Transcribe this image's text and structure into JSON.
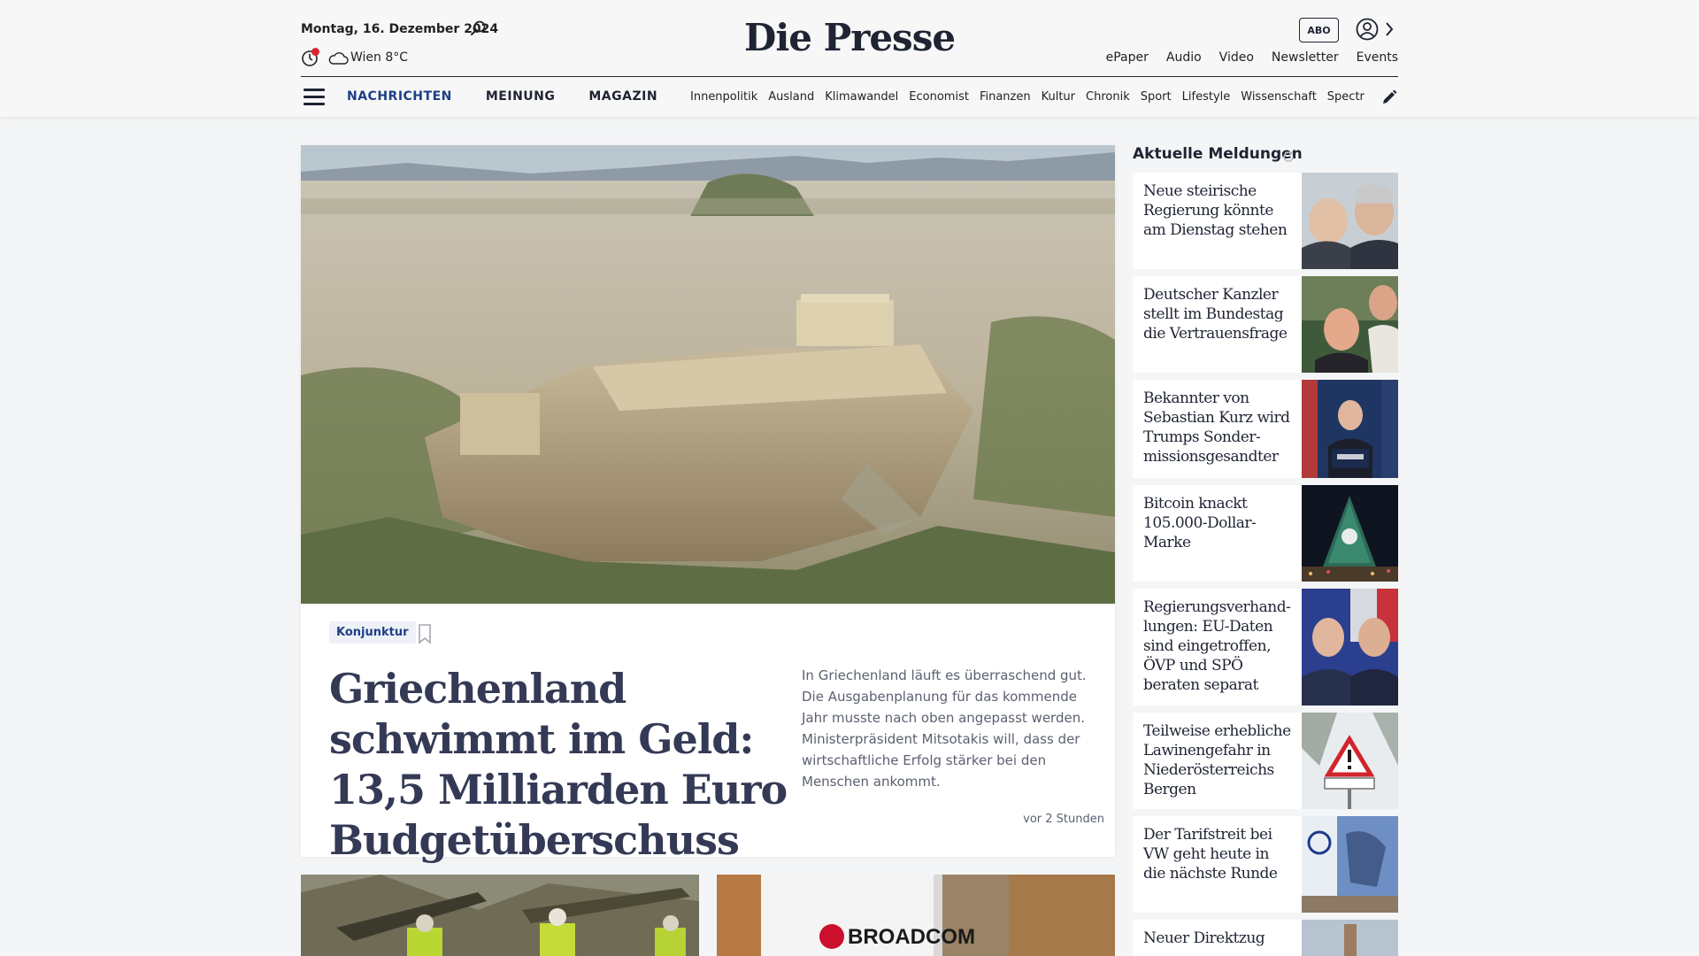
{
  "header": {
    "date": "Montag, 16. Dezember 2024",
    "weather": "Wien 8°C",
    "logo": "Die Presse",
    "abo_label": "ABO",
    "top_links": [
      "ePaper",
      "Audio",
      "Video",
      "Newsletter",
      "Events"
    ],
    "main_nav": [
      "NACHRICHTEN",
      "MEINUNG",
      "MAGAZIN"
    ],
    "sub_nav": [
      "Innenpolitik",
      "Ausland",
      "Klimawandel",
      "Economist",
      "Finanzen",
      "Kultur",
      "Chronik",
      "Sport",
      "Lifestyle",
      "Wissenschaft",
      "Spectrum"
    ]
  },
  "hero": {
    "tag": "Konjunktur",
    "title": "Griechenland schwimmt im Geld: 13,5 Milliarden Euro Budgetüberschuss",
    "teaser": "In Griechenland läuft es überraschend gut. Die Ausgabenplanung für das kommende Jahr musste nach oben angepasst werden. Ministerpräsident Mitsotakis will, dass der wirtschaftliche Erfolg stärker bei den Menschen ankommt.",
    "time": "vor 2 Stunden"
  },
  "bottom": {
    "broadcom_label": "BROADCOM"
  },
  "sidebar": {
    "heading": "Aktuelle Meldungen",
    "items": [
      {
        "title": "Neue steirische Regierung könnte am Dienstag stehen"
      },
      {
        "title": "Deutscher Kanzler stellt im Bundestag die Vertrauensfrage"
      },
      {
        "title": "Bekannter von Sebastian Kurz wird Trumps Sonder-missionsgesandter"
      },
      {
        "title": "Bitcoin knackt 105.000-Dollar-Marke"
      },
      {
        "title": "Regierungsverhand-lungen: EU-Daten sind eingetroffen, ÖVP und SPÖ beraten separat"
      },
      {
        "title": "Teilweise erhebliche Lawinengefahr in Niederösterreichs Bergen"
      },
      {
        "title": "Der Tarifstreit bei VW geht heute in die nächste Runde"
      },
      {
        "title": "Neuer Direktzug"
      }
    ]
  },
  "colors": {
    "brand_navy": "#1f2433",
    "nav_active": "#1d3f8a",
    "alert_red": "#d9272e",
    "page_bg": "#f4f5f6"
  }
}
